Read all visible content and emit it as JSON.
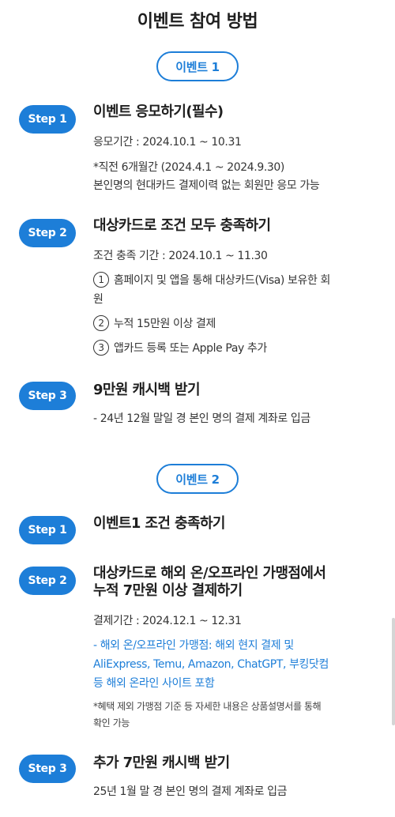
{
  "page": {
    "title": "이벤트 참여 방법"
  },
  "event1": {
    "label": "이벤트 1",
    "steps": [
      {
        "badge": "Step 1",
        "title": "이벤트 응모하기(필수)",
        "lines": [
          "응모기간 : 2024.10.1 ~ 10.31",
          "*직전 6개월간 (2024.4.1 ~ 2024.9.30)",
          "본인명의 현대카드 결제이력 없는 회원만 응모 가능"
        ]
      },
      {
        "badge": "Step 2",
        "title": "대상카드로 조건 모두 충족하기",
        "period": "조건 충족 기간 : 2024.10.1 ~ 11.30",
        "conditions": [
          {
            "num": "1",
            "text": "홈페이지 및 앱을 통해 대상카드(Visa) 보유한 회",
            "cont": "원"
          },
          {
            "num": "2",
            "text": "누적 15만원 이상 결제"
          },
          {
            "num": "3",
            "text": "앱카드 등록 또는 Apple Pay 추가"
          }
        ]
      },
      {
        "badge": "Step 3",
        "title": "9만원 캐시백 받기",
        "lines": [
          "- 24년 12월 말일 경 본인 명의 결제 계좌로 입금"
        ]
      }
    ]
  },
  "event2": {
    "label": "이벤트 2",
    "steps": [
      {
        "badge": "Step 1",
        "title": "이벤트1 조건 충족하기"
      },
      {
        "badge": "Step 2",
        "title_lines": [
          "대상카드로 해외 온/오프라인 가맹점에서",
          "누적 7만원 이상 결제하기"
        ],
        "period": "결제기간 : 2024.12.1 ~ 12.31",
        "blue_lines": [
          "- 해외 온/오프라인 가맹점: 해외 현지 결제 및",
          "AliExpress, Temu, Amazon, ChatGPT, 부킹닷컴",
          "등 해외 온라인 사이트 포함"
        ],
        "note_lines": [
          "*혜택 제외 가맹점 기준 등 자세한 내용은 상품설명서를 통해",
          "확인 가능"
        ]
      },
      {
        "badge": "Step 3",
        "title": "추가 7만원 캐시백 받기",
        "lines": [
          "25년 1월 말 경 본인 명의 결제 계좌로 입금"
        ]
      }
    ]
  },
  "colors": {
    "accent": "#1d7ed8",
    "text": "#222222"
  }
}
